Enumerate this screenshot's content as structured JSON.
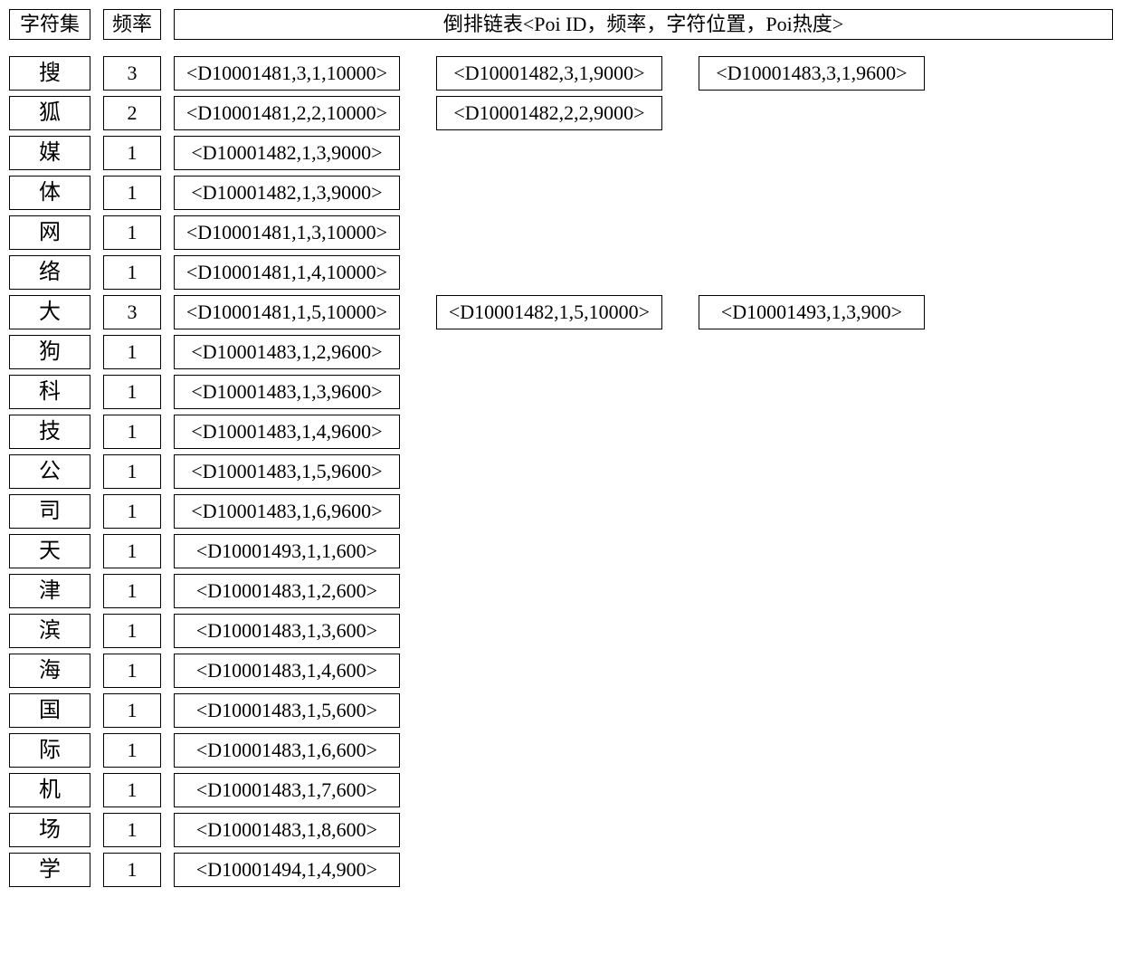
{
  "header": {
    "charset": "字符集",
    "freq": "频率",
    "list": "倒排链表<Poi ID，频率，字符位置，Poi热度>"
  },
  "rows": [
    {
      "char": "搜",
      "freq": "3",
      "tuples": [
        "<D10001481,3,1,10000>",
        "<D10001482,3,1,9000>",
        "<D10001483,3,1,9600>"
      ]
    },
    {
      "char": "狐",
      "freq": "2",
      "tuples": [
        "<D10001481,2,2,10000>",
        "<D10001482,2,2,9000>"
      ]
    },
    {
      "char": "媒",
      "freq": "1",
      "tuples": [
        "<D10001482,1,3,9000>"
      ]
    },
    {
      "char": "体",
      "freq": "1",
      "tuples": [
        "<D10001482,1,3,9000>"
      ]
    },
    {
      "char": "网",
      "freq": "1",
      "tuples": [
        "<D10001481,1,3,10000>"
      ]
    },
    {
      "char": "络",
      "freq": "1",
      "tuples": [
        "<D10001481,1,4,10000>"
      ]
    },
    {
      "char": "大",
      "freq": "3",
      "tuples": [
        "<D10001481,1,5,10000>",
        "<D10001482,1,5,10000>",
        "<D10001493,1,3,900>"
      ]
    },
    {
      "char": "狗",
      "freq": "1",
      "tuples": [
        "<D10001483,1,2,9600>"
      ]
    },
    {
      "char": "科",
      "freq": "1",
      "tuples": [
        "<D10001483,1,3,9600>"
      ]
    },
    {
      "char": "技",
      "freq": "1",
      "tuples": [
        "<D10001483,1,4,9600>"
      ]
    },
    {
      "char": "公",
      "freq": "1",
      "tuples": [
        "<D10001483,1,5,9600>"
      ]
    },
    {
      "char": "司",
      "freq": "1",
      "tuples": [
        "<D10001483,1,6,9600>"
      ]
    },
    {
      "char": "天",
      "freq": "1",
      "tuples": [
        "<D10001493,1,1,600>"
      ]
    },
    {
      "char": "津",
      "freq": "1",
      "tuples": [
        "<D10001483,1,2,600>"
      ]
    },
    {
      "char": "滨",
      "freq": "1",
      "tuples": [
        "<D10001483,1,3,600>"
      ]
    },
    {
      "char": "海",
      "freq": "1",
      "tuples": [
        "<D10001483,1,4,600>"
      ]
    },
    {
      "char": "国",
      "freq": "1",
      "tuples": [
        "<D10001483,1,5,600>"
      ]
    },
    {
      "char": "际",
      "freq": "1",
      "tuples": [
        "<D10001483,1,6,600>"
      ]
    },
    {
      "char": "机",
      "freq": "1",
      "tuples": [
        "<D10001483,1,7,600>"
      ]
    },
    {
      "char": "场",
      "freq": "1",
      "tuples": [
        "<D10001483,1,8,600>"
      ]
    },
    {
      "char": "学",
      "freq": "1",
      "tuples": [
        "<D10001494,1,4,900>"
      ]
    }
  ]
}
